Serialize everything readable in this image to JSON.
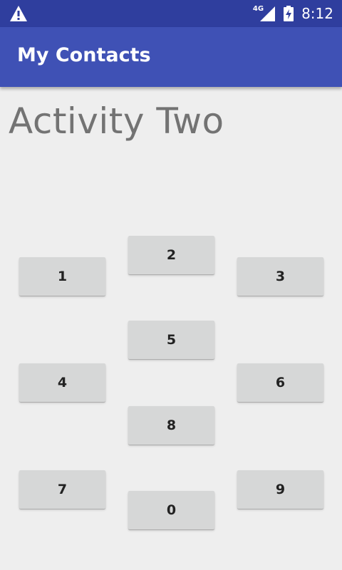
{
  "status_bar": {
    "network_type": "4G",
    "time": "8:12",
    "icons": [
      "warning-icon",
      "signal-icon",
      "battery-charging-icon"
    ]
  },
  "app_bar": {
    "title": "My Contacts"
  },
  "main": {
    "heading": "Activity Two",
    "keypad": {
      "keys": [
        "1",
        "2",
        "3",
        "4",
        "5",
        "6",
        "7",
        "8",
        "9",
        "0"
      ]
    }
  },
  "colors": {
    "status_bar": "#2f3e9e",
    "app_bar": "#3f51b5",
    "background": "#eeeeee",
    "button": "#d6d7d7",
    "heading_text": "#737373"
  }
}
